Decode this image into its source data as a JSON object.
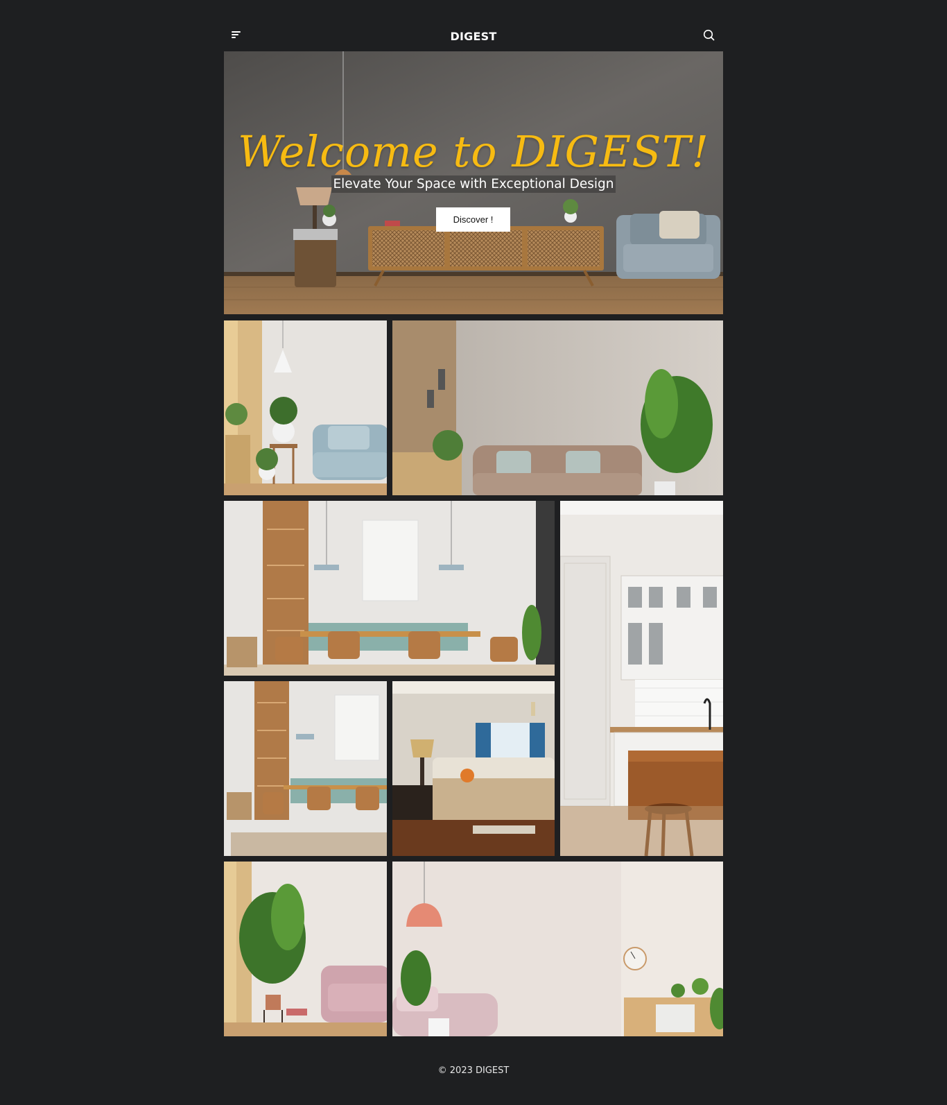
{
  "header": {
    "brand": "DIGEST",
    "menu_icon": "menu-icon",
    "search_icon": "search-icon"
  },
  "hero": {
    "title": "Welcome to DIGEST!",
    "subtitle": "Elevate Your Space with Exceptional Design",
    "cta_label": "Discover !",
    "accent_color": "#f7bb12"
  },
  "gallery": {
    "tiles": [
      "living-room-blue-sofa",
      "living-room-beige-sofa",
      "dining-room-wide",
      "white-kitchen",
      "dining-room-small",
      "bedroom",
      "pink-armchair-room",
      "pink-sofa-room"
    ]
  },
  "footer": {
    "copyright": "© 2023 DIGEST"
  }
}
